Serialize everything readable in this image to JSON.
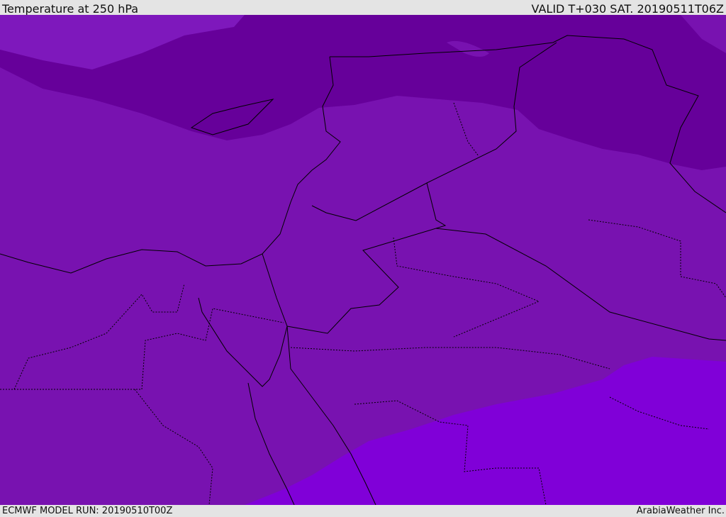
{
  "header": {
    "title": "Temperature at 250 hPa",
    "valid": "VALID T+030 SAT. 20190511T06Z"
  },
  "footer": {
    "model_run": "ECMWF MODEL RUN: 20190510T00Z",
    "credit": "ArabiaWeather Inc."
  },
  "colors": {
    "mid": "#7812b0",
    "dark": "#66009a",
    "light": "#7c14bc",
    "bright": "#8000d8",
    "bar": "#e4e4e4"
  }
}
